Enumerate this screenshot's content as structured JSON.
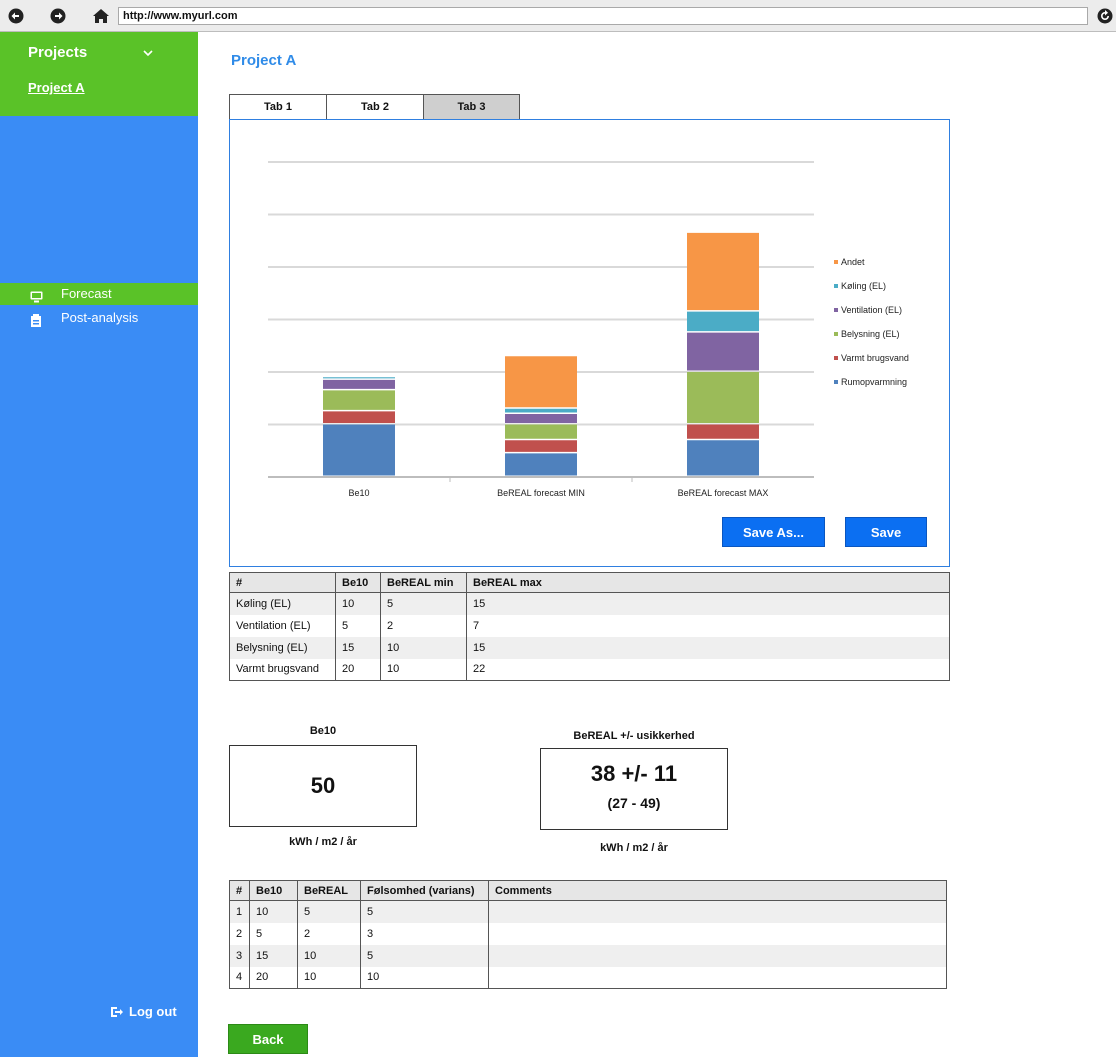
{
  "browser": {
    "url": "http://www.myurl.com"
  },
  "sidebar": {
    "projects_label": "Projects",
    "project_link": "Project A",
    "items": [
      {
        "label": "Forecast",
        "icon": "monitor-icon",
        "active": true
      },
      {
        "label": "Post-analysis",
        "icon": "report-icon",
        "active": false
      }
    ],
    "logout_label": "Log out"
  },
  "main": {
    "title": "Project A",
    "tabs": [
      "Tab 1",
      "Tab 2",
      "Tab 3"
    ],
    "active_tab": 2,
    "save_as_label": "Save As...",
    "save_label": "Save",
    "back_label": "Back"
  },
  "chart_data": {
    "type": "bar",
    "stacked": true,
    "categories": [
      "Be10",
      "BeREAL forecast MIN",
      "BeREAL forecast MAX"
    ],
    "ylim": [
      0,
      60
    ],
    "grid": true,
    "legend_placement": "right",
    "series": [
      {
        "name": "Rumopvarmning",
        "color": "#4f81bd",
        "values": [
          10,
          4.5,
          7
        ]
      },
      {
        "name": "Varmt brugsvand",
        "color": "#c0504d",
        "values": [
          2.5,
          2.5,
          3
        ]
      },
      {
        "name": "Belysning (EL)",
        "color": "#9bbb59",
        "values": [
          4,
          3,
          10
        ]
      },
      {
        "name": "Ventilation (EL)",
        "color": "#8064a2",
        "values": [
          2,
          2,
          7.5
        ]
      },
      {
        "name": "Køling (EL)",
        "color": "#4bacc6",
        "values": [
          0.5,
          1,
          4
        ]
      },
      {
        "name": "Andet",
        "color": "#f79646",
        "values": [
          0,
          10,
          15
        ]
      }
    ]
  },
  "table1": {
    "headers": [
      "#",
      "Be10",
      "BeREAL min",
      "BeREAL max"
    ],
    "rows": [
      [
        "Køling (EL)",
        "10",
        "5",
        "15"
      ],
      [
        "Ventilation (EL)",
        "5",
        "2",
        "7"
      ],
      [
        "Belysning (EL)",
        "15",
        "10",
        "15"
      ],
      [
        "Varmt brugsvand",
        "20",
        "10",
        "22"
      ]
    ]
  },
  "kpi": {
    "be10_label": "Be10",
    "be10_value": "50",
    "be10_unit": "kWh / m2 / år",
    "bereal_label": "BeREAL +/- usikkerhed",
    "bereal_value": "38 +/- 11",
    "bereal_range": "(27 - 49)",
    "bereal_unit": "kWh / m2 / år"
  },
  "table2": {
    "headers": [
      "#",
      "Be10",
      "BeREAL",
      "Følsomhed (varians)",
      "Comments"
    ],
    "rows": [
      [
        "1",
        "10",
        "5",
        "5",
        ""
      ],
      [
        "2",
        "5",
        "2",
        "3",
        ""
      ],
      [
        "3",
        "15",
        "10",
        "5",
        ""
      ],
      [
        "4",
        "20",
        "10",
        "10",
        ""
      ]
    ]
  }
}
